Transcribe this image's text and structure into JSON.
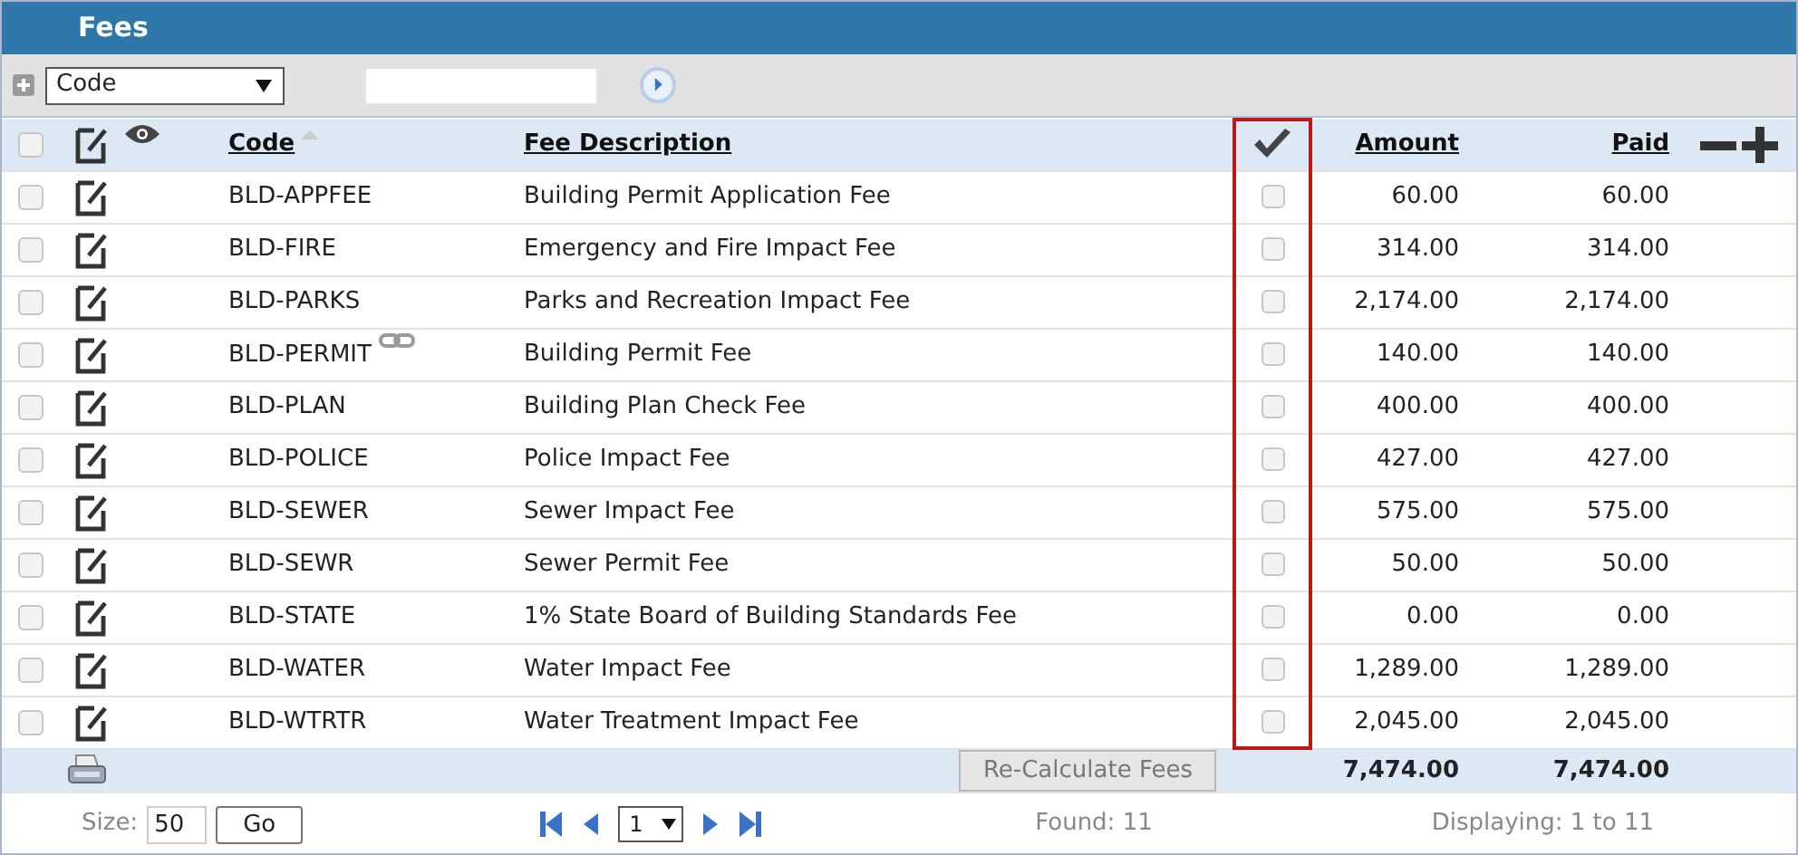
{
  "panel": {
    "title": "Fees"
  },
  "filter": {
    "field": "Code"
  },
  "all_selected": false,
  "columns": [
    {
      "label": "Code",
      "sorted": true
    },
    {
      "label": "Fee Description",
      "sorted": false
    },
    {
      "label": "Amount",
      "sorted": false
    },
    {
      "label": "Paid",
      "sorted": false
    }
  ],
  "rows": [
    {
      "code": "BLD-APPFEE",
      "linked": false,
      "description": "Building Permit Application Fee",
      "applied": false,
      "selected": false,
      "amount": "60.00",
      "paid": "60.00"
    },
    {
      "code": "BLD-FIRE",
      "linked": false,
      "description": "Emergency and Fire Impact Fee",
      "applied": false,
      "selected": false,
      "amount": "314.00",
      "paid": "314.00"
    },
    {
      "code": "BLD-PARKS",
      "linked": false,
      "description": "Parks and Recreation Impact Fee",
      "applied": false,
      "selected": false,
      "amount": "2,174.00",
      "paid": "2,174.00"
    },
    {
      "code": "BLD-PERMIT",
      "linked": true,
      "description": "Building Permit Fee",
      "applied": false,
      "selected": false,
      "amount": "140.00",
      "paid": "140.00"
    },
    {
      "code": "BLD-PLAN",
      "linked": false,
      "description": "Building Plan Check Fee",
      "applied": false,
      "selected": false,
      "amount": "400.00",
      "paid": "400.00"
    },
    {
      "code": "BLD-POLICE",
      "linked": false,
      "description": "Police Impact Fee",
      "applied": false,
      "selected": false,
      "amount": "427.00",
      "paid": "427.00"
    },
    {
      "code": "BLD-SEWER",
      "linked": false,
      "description": "Sewer Impact Fee",
      "applied": false,
      "selected": false,
      "amount": "575.00",
      "paid": "575.00"
    },
    {
      "code": "BLD-SEWR",
      "linked": false,
      "description": "Sewer Permit Fee",
      "applied": false,
      "selected": false,
      "amount": "50.00",
      "paid": "50.00"
    },
    {
      "code": "BLD-STATE",
      "linked": false,
      "description": "1% State Board of Building Standards Fee",
      "applied": false,
      "selected": false,
      "amount": "0.00",
      "paid": "0.00"
    },
    {
      "code": "BLD-WATER",
      "linked": false,
      "description": "Water Impact Fee",
      "applied": false,
      "selected": false,
      "amount": "1,289.00",
      "paid": "1,289.00"
    },
    {
      "code": "BLD-WTRTR",
      "linked": false,
      "description": "Water Treatment Impact Fee",
      "applied": false,
      "selected": false,
      "amount": "2,045.00",
      "paid": "2,045.00"
    }
  ],
  "totals": {
    "button": "Re-Calculate Fees",
    "amount": "7,474.00",
    "paid": "7,474.00"
  },
  "pager": {
    "size_label": "Size:",
    "size": "50",
    "go": "Go",
    "page": "1",
    "found": "Found: 11",
    "displaying": "Displaying: 1 to 11"
  }
}
